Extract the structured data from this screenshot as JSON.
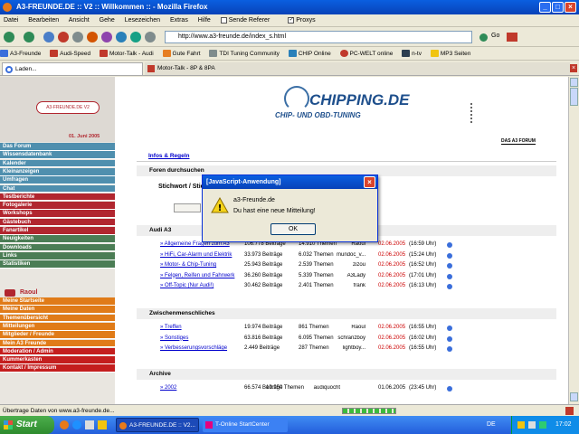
{
  "window": {
    "title": "A3-FREUNDE.DE :: V2 :: Willkommen :: - Mozilla Firefox"
  },
  "menu": [
    "Datei",
    "Bearbeiten",
    "Ansicht",
    "Gehe",
    "Lesezeichen",
    "Extras",
    "Hilfe"
  ],
  "menu_checks": [
    {
      "label": "Sende Referer",
      "checked": false
    },
    {
      "label": "Proxys",
      "checked": true
    }
  ],
  "nav": {
    "url": "http://www.a3-freunde.de/index_s.html",
    "go": "Go"
  },
  "bookmarks": [
    "A3-Freunde",
    "Audi-Speed",
    "Motor-Talk - Audi",
    "Gute Fahrt",
    "TDI Tuning Community",
    "CHIP Online",
    "PC-WELT online",
    "n-tv",
    "MP3 Seiten"
  ],
  "tabs": [
    "Laden...",
    "Motor-Talk - 8P & 8PA"
  ],
  "site": {
    "logo": "A3-FREUNDE.DE V2",
    "date": "01. Juni 2005",
    "banner_title": "CHIPPING.DE",
    "banner_sub": "CHIP- UND OBD-TUNING",
    "forum_label": "DAS A3 FORUM"
  },
  "sidebar": [
    {
      "label": "Das Forum",
      "color": "#4f8fae"
    },
    {
      "label": "Wissensdatenbank",
      "color": "#4f8fae"
    },
    {
      "label": "Kalender",
      "color": "#4f8fae"
    },
    {
      "label": "Kleinanzeigen",
      "color": "#4f8fae"
    },
    {
      "label": "Umfragen",
      "color": "#4f8fae"
    },
    {
      "label": "Chat",
      "color": "#4f8fae"
    },
    {
      "label": "Testberichte",
      "color": "#b1262f"
    },
    {
      "label": "Fotogalerie",
      "color": "#b1262f"
    },
    {
      "label": "Workshops",
      "color": "#b1262f"
    },
    {
      "label": "Gästebuch",
      "color": "#b1262f"
    },
    {
      "label": "Fanartikel",
      "color": "#b1262f"
    },
    {
      "label": "Neuigkeiten",
      "color": "#4b7d55"
    },
    {
      "label": "Downloads",
      "color": "#4b7d55"
    },
    {
      "label": "Links",
      "color": "#4b7d55"
    },
    {
      "label": "Statistiken",
      "color": "#4b7d55"
    }
  ],
  "user": {
    "name": "Raoul"
  },
  "user_menu": [
    {
      "label": "Meine Startseite",
      "color": "#e07b18"
    },
    {
      "label": "Meine Daten",
      "color": "#e07b18"
    },
    {
      "label": "Themenübersicht",
      "color": "#e07b18"
    },
    {
      "label": "Mitteilungen",
      "color": "#e07b18"
    },
    {
      "label": "Mitglieder / Freunde",
      "color": "#e07b18"
    },
    {
      "label": "Mein A3 Freunde",
      "color": "#e07b18"
    },
    {
      "label": "Moderation / Admin",
      "color": "#c41e1e"
    },
    {
      "label": "Kummerkasten",
      "color": "#c41e1e"
    },
    {
      "label": "Kontakt / Impressum",
      "color": "#c41e1e"
    }
  ],
  "main": {
    "info_title": "Infos & Regeln",
    "search_title": "Foren durchsuchen",
    "search_label": "Stichwort / Stichwörter:"
  },
  "sections": [
    {
      "title": "Audi A3",
      "rows": [
        {
          "name": "» Allgemeine Fragen zum A3",
          "posts": "106.778 Beiträge",
          "topics": "14.910 Themen",
          "user": "Raoul",
          "date": "02.06.2005",
          "time": "(16:59 Uhr)"
        },
        {
          "name": "» HiFi, Car-Alarm und Elektrik",
          "posts": "33.973 Beiträge",
          "topics": "6.032 Themen",
          "user": "mundoc_v...",
          "date": "02.06.2005",
          "time": "(15:24 Uhr)"
        },
        {
          "name": "» Motor- & Chip-Tuning",
          "posts": "25.943 Beiträge",
          "topics": "2.539 Themen",
          "user": "zizou",
          "date": "02.06.2005",
          "time": "(16:52 Uhr)"
        },
        {
          "name": "» Felgen, Reifen und Fahrwerk",
          "posts": "36.260 Beiträge",
          "topics": "5.339 Themen",
          "user": "A3Lady",
          "date": "02.06.2005",
          "time": "(17:01 Uhr)"
        },
        {
          "name": "» Off-Topic (Nur Audi!)",
          "posts": "30.462 Beiträge",
          "topics": "2.401 Themen",
          "user": "frank",
          "date": "02.06.2005",
          "time": "(16:13 Uhr)"
        }
      ]
    },
    {
      "title": "Zwischenmenschliches",
      "rows": [
        {
          "name": "» Treffen",
          "posts": "19.974 Beiträge",
          "topics": "861 Themen",
          "user": "Raoul",
          "date": "02.06.2005",
          "time": "(16:55 Uhr)"
        },
        {
          "name": "» Sonstiges",
          "posts": "63.816 Beiträge",
          "topics": "6.095 Themen",
          "user": "schranzboy",
          "date": "02.06.2005",
          "time": "(16:02 Uhr)"
        },
        {
          "name": "» Verbesserungsvorschläge",
          "posts": "2.449 Beiträge",
          "topics": "287 Themen",
          "user": "lightboy...",
          "date": "02.06.2005",
          "time": "(16:55 Uhr)"
        }
      ]
    },
    {
      "title": "Archive",
      "rows": [
        {
          "name": "» 2002",
          "posts": "66.574 Beiträge",
          "topics": "10.950 Themen",
          "user": "audiquocht",
          "date": "01.06.2005",
          "time": "(23:45 Uhr)"
        }
      ]
    }
  ],
  "dialog": {
    "title": "[JavaScript-Anwendung]",
    "line1": "a3-Freunde.de",
    "line2": "Du hast eine neue Mitteilung!",
    "ok": "OK"
  },
  "status": "Übertrage Daten von www.a3-freunde.de...",
  "taskbar": {
    "start": "Start",
    "tasks": [
      "A3-FREUNDE.DE :: V2...",
      "T-Online StartCenter"
    ],
    "lang": "DE",
    "clock": "17:02"
  }
}
